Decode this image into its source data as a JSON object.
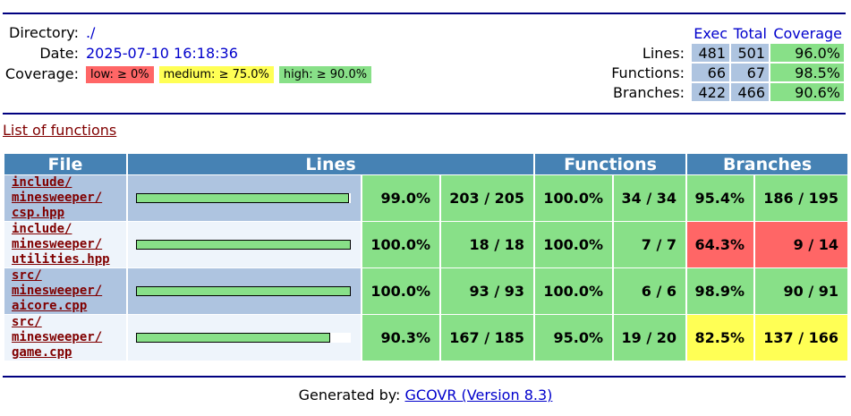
{
  "header": {
    "directory_label": "Directory:",
    "directory_value": "./",
    "date_label": "Date:",
    "date_value": "2025-07-10 16:18:36",
    "coverage_label": "Coverage:",
    "legend": {
      "low": "low: ≥ 0%",
      "medium": "medium: ≥ 75.0%",
      "high": "high: ≥ 90.0%"
    }
  },
  "summary": {
    "col_exec": "Exec",
    "col_total": "Total",
    "col_coverage": "Coverage",
    "rows": [
      {
        "label": "Lines:",
        "exec": "481",
        "total": "501",
        "coverage": "96.0%"
      },
      {
        "label": "Functions:",
        "exec": "66",
        "total": "67",
        "coverage": "98.5%"
      },
      {
        "label": "Branches:",
        "exec": "422",
        "total": "466",
        "coverage": "90.6%"
      }
    ]
  },
  "list_link": "List of functions",
  "table": {
    "headers": {
      "file": "File",
      "lines": "Lines",
      "functions": "Functions",
      "branches": "Branches"
    },
    "rows": [
      {
        "file": [
          "include/",
          "minesweeper/",
          "csp.hpp"
        ],
        "line_fraction": 0.99,
        "line_pct": "99.0%",
        "line_ratio": "203 / 205",
        "line_class": "high",
        "func_pct": "100.0%",
        "func_ratio": "34 / 34",
        "func_class": "high",
        "branch_pct": "95.4%",
        "branch_ratio": "186 / 195",
        "branch_class": "high"
      },
      {
        "file": [
          "include/",
          "minesweeper/",
          "utilities.hpp"
        ],
        "line_fraction": 1.0,
        "line_pct": "100.0%",
        "line_ratio": "18 / 18",
        "line_class": "high",
        "func_pct": "100.0%",
        "func_ratio": "7 / 7",
        "func_class": "high",
        "branch_pct": "64.3%",
        "branch_ratio": "9 / 14",
        "branch_class": "low"
      },
      {
        "file": [
          "src/",
          "minesweeper/",
          "aicore.cpp"
        ],
        "line_fraction": 1.0,
        "line_pct": "100.0%",
        "line_ratio": "93 / 93",
        "line_class": "high",
        "func_pct": "100.0%",
        "func_ratio": "6 / 6",
        "func_class": "high",
        "branch_pct": "98.9%",
        "branch_ratio": "90 / 91",
        "branch_class": "high"
      },
      {
        "file": [
          "src/",
          "minesweeper/",
          "game.cpp"
        ],
        "line_fraction": 0.903,
        "line_pct": "90.3%",
        "line_ratio": "167 / 185",
        "line_class": "high",
        "func_pct": "95.0%",
        "func_ratio": "19 / 20",
        "func_class": "high",
        "branch_pct": "82.5%",
        "branch_ratio": "137 / 166",
        "branch_class": "medium"
      }
    ]
  },
  "footer": {
    "prefix": "Generated by: ",
    "link": "GCOVR (Version 8.3)"
  },
  "colors": {
    "header_bg": "#4682b4",
    "high": "#88e088",
    "medium": "#ffff55",
    "low": "#ff6666",
    "rule": "#000080",
    "link": "#0000cc",
    "file_link": "#800000"
  }
}
